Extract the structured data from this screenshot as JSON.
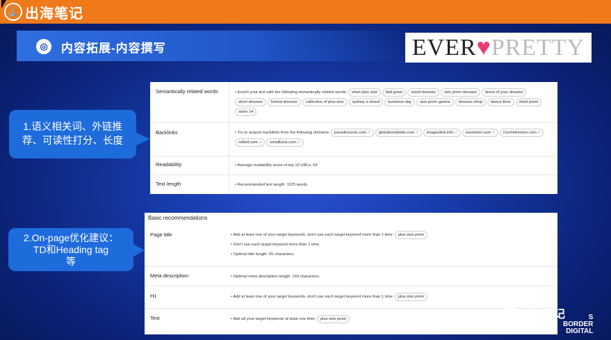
{
  "header": {
    "logo_text": "出海笔记",
    "slide_title": "内容拓展-内容撰写",
    "brand_part1": "EVER",
    "brand_heart": "♥",
    "brand_part2": "PRETTY"
  },
  "callouts": [
    {
      "lines": [
        "1.语义相关词、外链推",
        "荐、可读性打分、长度"
      ]
    },
    {
      "lines": [
        "2.On-page优化建议：",
        "TD和Heading tag",
        "等"
      ]
    }
  ],
  "panel1": {
    "rows": [
      {
        "label": "Semantically related words",
        "intro": "• Enrich your text with the following semantically related words:",
        "chips": [
          "short plus size",
          "ball gown",
          "sized dresses",
          "size prom dresses",
          "dress of your dreams",
          "short dresses",
          "formal dresses",
          "collection of plus size",
          "sydney s closet",
          "business day",
          "size prom gowns",
          "dresses shop",
          "dance floor",
          "short prom",
          "sizes 14"
        ]
      },
      {
        "label": "Backlinks",
        "intro": "• Try to acquire backlinks from the following domains:",
        "chips": [
          "juicedmuscle.com",
          "globalrentalsite.com",
          "imageslink.info",
          "eurekster.com",
          "crochetnmore.com",
          "milled.com",
          "emailtuna.com"
        ]
      },
      {
        "label": "Readability",
        "text": "• Average readability score of top 10 URLs: 69"
      },
      {
        "label": "Text length",
        "text": "• Recommended text length: 1125 words"
      }
    ]
  },
  "panel2": {
    "heading": "Basic recommendations",
    "rows": [
      {
        "label": "Page title",
        "lines": [
          "• Add at least one of your target keywords, don't use each target keyword more than 1 time:",
          "• Don't use each target keyword more than 1 time.",
          "• Optimal title length: 55 characters."
        ],
        "chip": "plus size prom"
      },
      {
        "label": "Meta description",
        "lines": [
          "• Optimal meta description length: 160 characters."
        ]
      },
      {
        "label": "H1",
        "lines": [
          "• Add at least one of your target keywords, don't use each target keyword more than 1 time:"
        ],
        "chip": "plus size prom"
      },
      {
        "label": "Text",
        "lines": [
          "• Add all your target keywords at least one time:"
        ],
        "chip": "plus size prom"
      }
    ]
  },
  "watermark": {
    "text": "出海笔记",
    "bd_lines": [
      "S",
      "BORDER",
      "DIGITAL"
    ]
  }
}
